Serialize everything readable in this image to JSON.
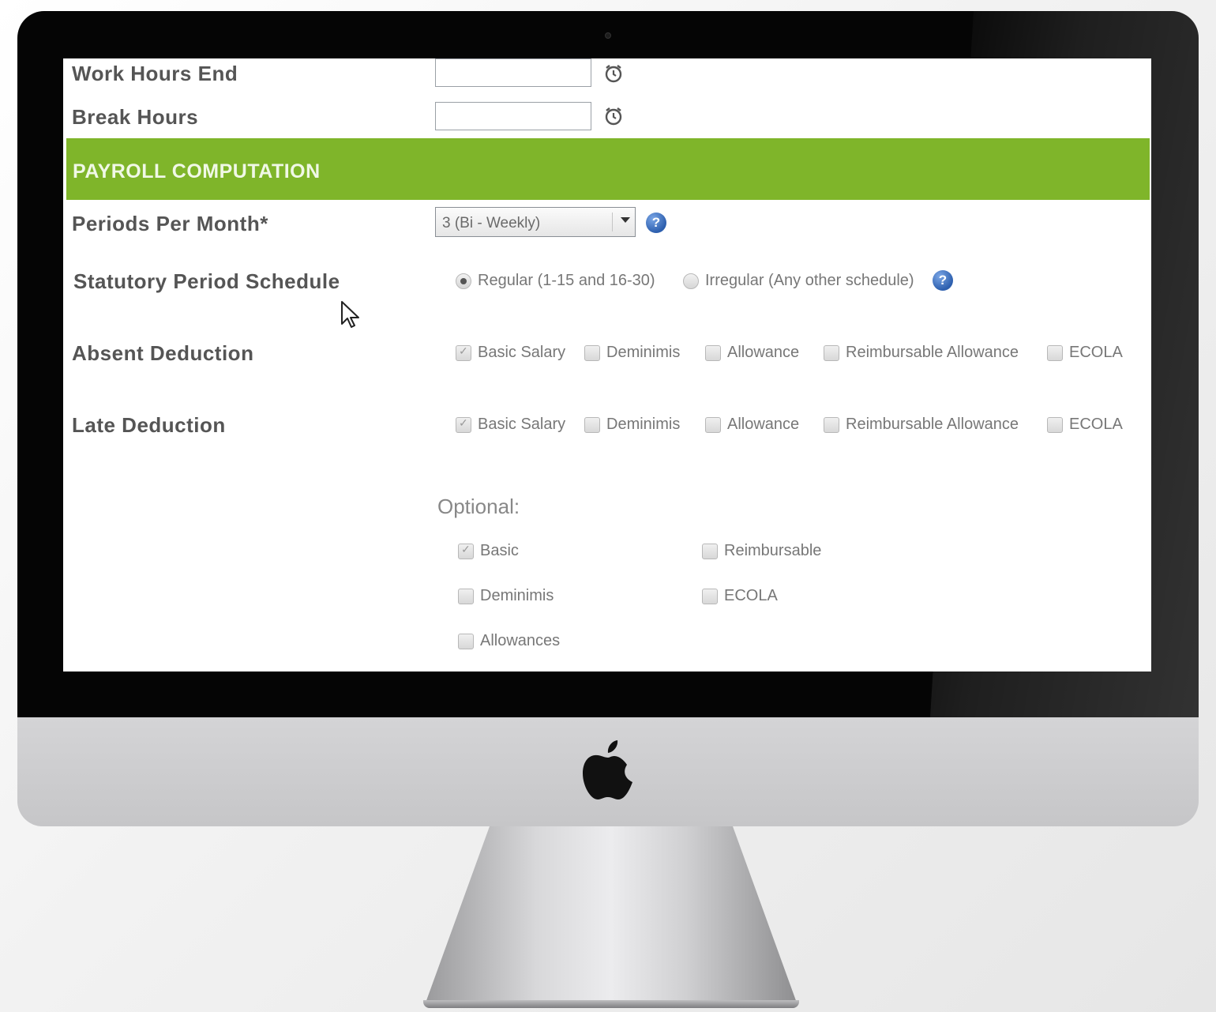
{
  "form": {
    "work_hours_end_label": "Work Hours End",
    "break_hours_label": "Break Hours",
    "work_hours_end_value": "",
    "break_hours_value": ""
  },
  "section": {
    "title": "PAYROLL COMPUTATION",
    "color": "#7fb52a"
  },
  "periods": {
    "label": "Periods Per Month*",
    "selected": "3 (Bi - Weekly)"
  },
  "statutory": {
    "label": "Statutory Period Schedule",
    "options": [
      {
        "label": "Regular (1-15 and 16-30)",
        "checked": true
      },
      {
        "label": "Irregular (Any other schedule)",
        "checked": false
      }
    ]
  },
  "absent": {
    "label": "Absent Deduction",
    "options": [
      {
        "label": "Basic Salary",
        "checked": true
      },
      {
        "label": "Deminimis",
        "checked": false
      },
      {
        "label": "Allowance",
        "checked": false
      },
      {
        "label": "Reimbursable Allowance",
        "checked": false
      },
      {
        "label": "ECOLA",
        "checked": false
      }
    ]
  },
  "late": {
    "label": "Late Deduction",
    "options": [
      {
        "label": "Basic Salary",
        "checked": true
      },
      {
        "label": "Deminimis",
        "checked": false
      },
      {
        "label": "Allowance",
        "checked": false
      },
      {
        "label": "Reimbursable Allowance",
        "checked": false
      },
      {
        "label": "ECOLA",
        "checked": false
      }
    ]
  },
  "optional": {
    "title": "Optional:",
    "options": [
      {
        "label": "Basic",
        "checked": true
      },
      {
        "label": "Reimbursable",
        "checked": false
      },
      {
        "label": "Deminimis",
        "checked": false
      },
      {
        "label": "ECOLA",
        "checked": false
      },
      {
        "label": "Allowances",
        "checked": false
      }
    ]
  },
  "icons": {
    "clock": "alarm-clock-icon",
    "help": "help-icon",
    "help_glyph": "?",
    "logo": "apple-logo-icon"
  }
}
